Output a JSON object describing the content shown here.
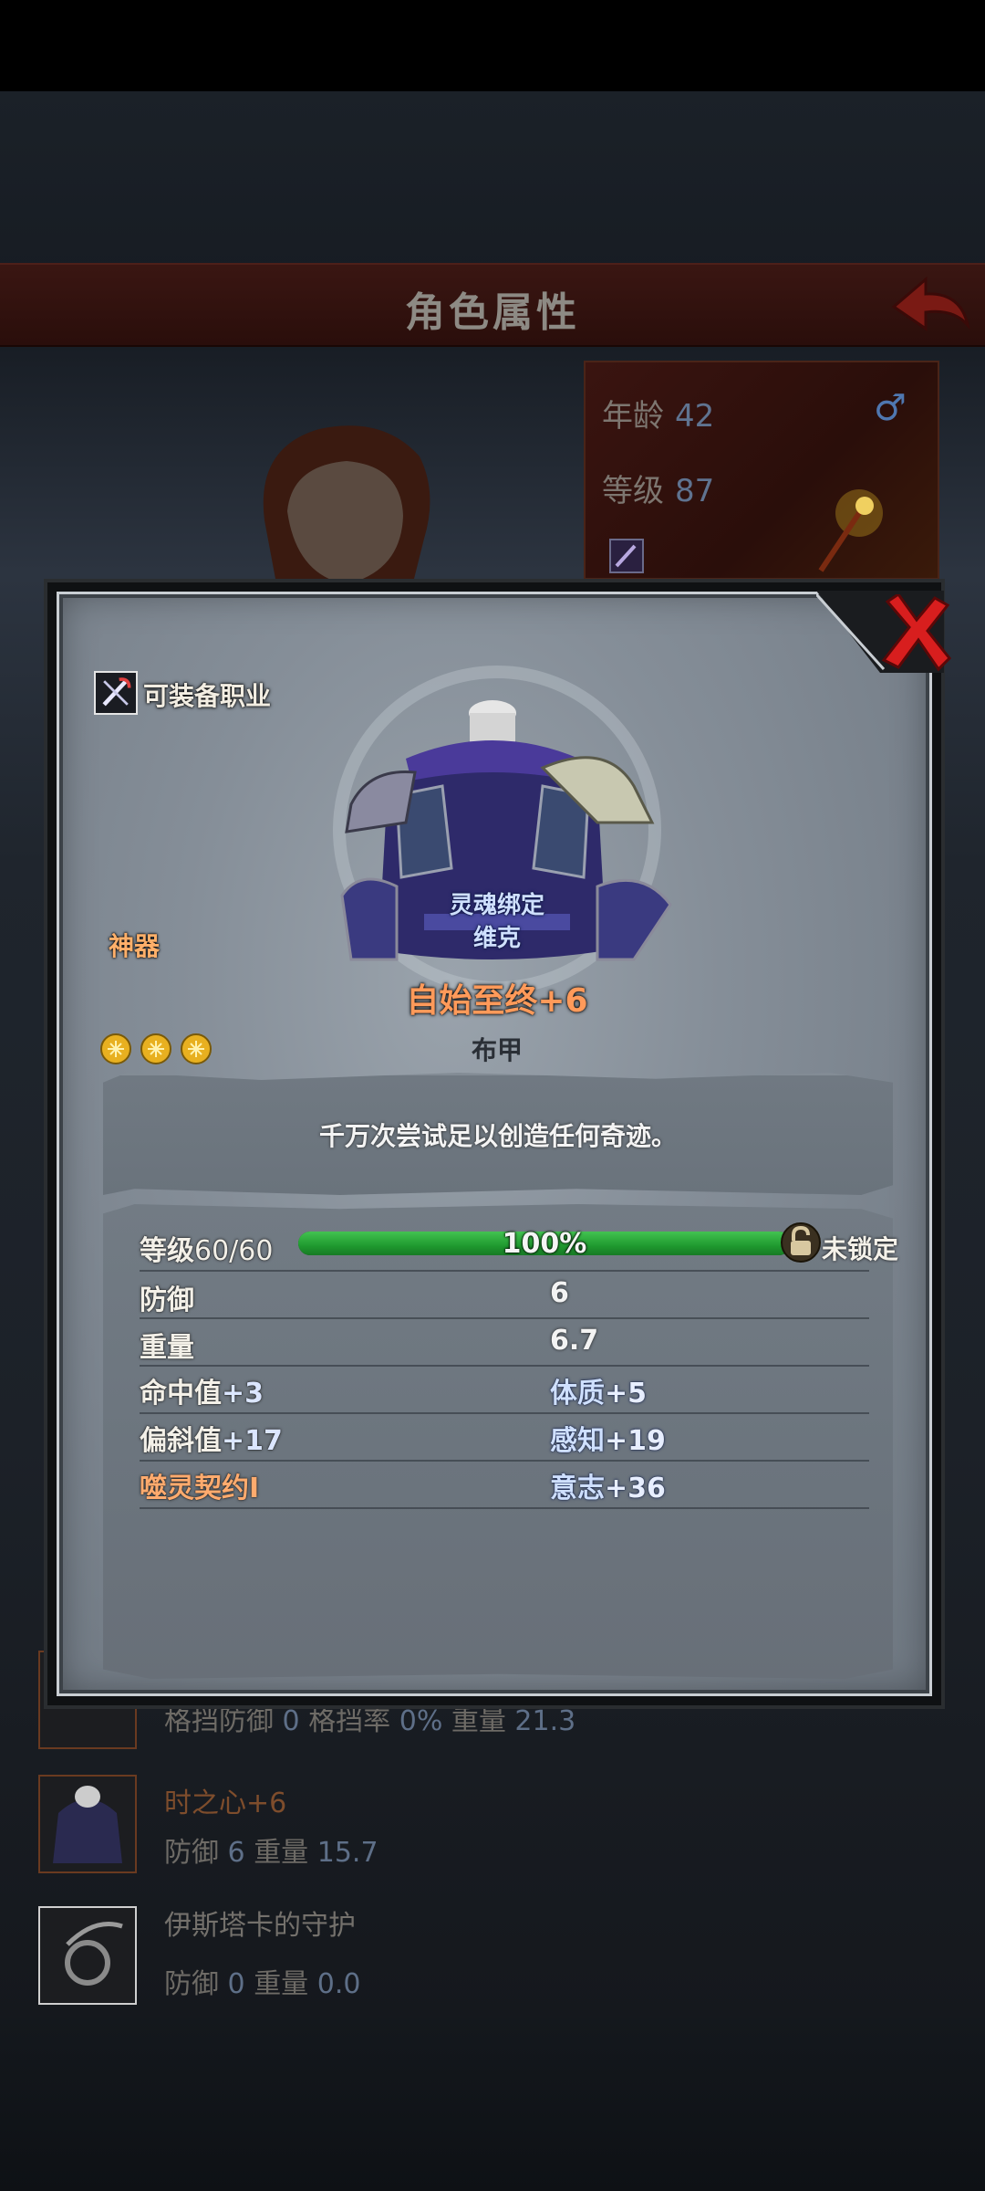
{
  "background": {
    "title": "角色属性",
    "info": {
      "age_label": "年龄",
      "age_value": "42",
      "level_label": "等级",
      "level_value": "87"
    },
    "list": [
      {
        "name": "",
        "stats_a_label": "格挡防御",
        "stats_a_value": "0",
        "stats_b_label": "格挡率",
        "stats_b_value": "0%",
        "stats_c_label": "重量",
        "stats_c_value": "21.3"
      },
      {
        "name": "时之心+6",
        "stats_a_label": "防御",
        "stats_a_value": "6",
        "stats_c_label": "重量",
        "stats_c_value": "15.7"
      },
      {
        "name": "伊斯塔卡的守护",
        "stats_a_label": "防御",
        "stats_a_value": "0",
        "stats_c_label": "重量",
        "stats_c_value": "0.0"
      }
    ]
  },
  "dialog": {
    "job_label": "可装备职业",
    "rarity": "神器",
    "bound_line1": "灵魂绑定",
    "bound_line2": "维克",
    "item_name": "自始至终+6",
    "item_type": "布甲",
    "stars_count": 3,
    "description": "千万次尝试足以创造任何奇迹。",
    "level": {
      "label": "等级",
      "value": "60/60",
      "progress_percent": 100,
      "progress_text": "100%",
      "lock_label": "未锁定"
    },
    "stats": {
      "defense_label": "防御",
      "defense_value": "6",
      "weight_label": "重量",
      "weight_value": "6.7"
    },
    "bonuses": {
      "left": [
        {
          "label": "命中值",
          "value": "+3"
        },
        {
          "label": "偏斜值",
          "value": "+17"
        },
        {
          "label": "噬灵契约I",
          "value": ""
        }
      ],
      "right": [
        {
          "label": "体质",
          "value": "+5"
        },
        {
          "label": "感知",
          "value": "+19"
        },
        {
          "label": "意志",
          "value": "+36"
        }
      ]
    }
  },
  "colors": {
    "rarity": "#ffb06a",
    "item_name": "#ff9a5a",
    "progress": "#2fb040",
    "close": "#d81e1e"
  }
}
